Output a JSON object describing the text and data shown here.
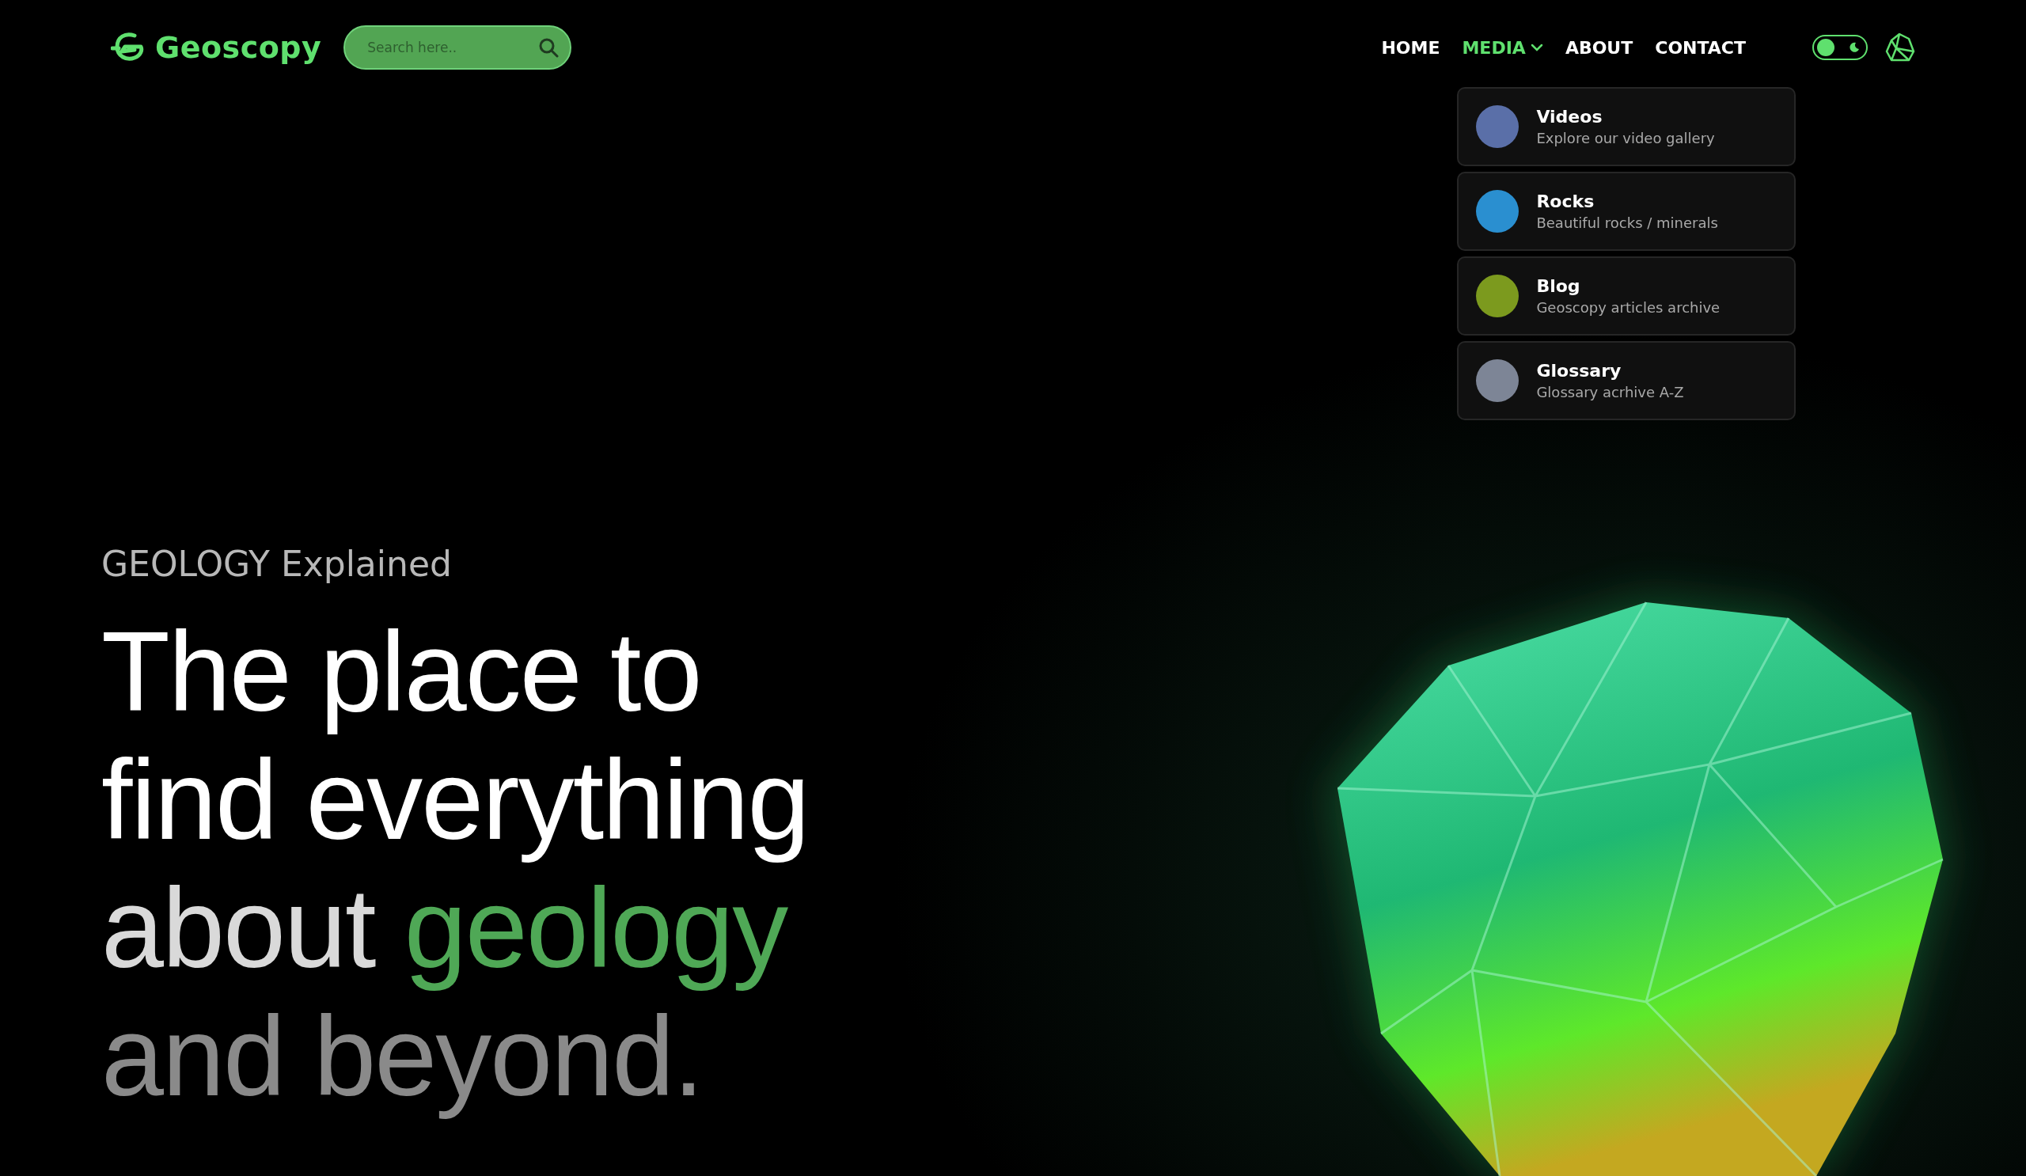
{
  "brand": {
    "name": "Geoscopy"
  },
  "search": {
    "placeholder": "Search here.."
  },
  "nav": [
    {
      "label": "HOME",
      "selected": false,
      "kind": "link"
    },
    {
      "label": "MEDIA",
      "selected": true,
      "kind": "menu"
    },
    {
      "label": "ABOUT",
      "selected": false,
      "kind": "link"
    },
    {
      "label": "CONTACT",
      "selected": false,
      "kind": "link"
    }
  ],
  "theme_toggle": {
    "on": false
  },
  "media_menu": [
    {
      "title": "Videos",
      "subtitle": "Explore our video gallery",
      "color": "#5a6fa8"
    },
    {
      "title": "Rocks",
      "subtitle": "Beautiful rocks / minerals",
      "color": "#2a8fd0"
    },
    {
      "title": "Blog",
      "subtitle": "Geoscopy articles archive",
      "color": "#7c9a1e"
    },
    {
      "title": "Glossary",
      "subtitle": "Glossary acrhive A-Z",
      "color": "#7d8596"
    }
  ],
  "hero": {
    "eyebrow": "GEOLOGY Explained",
    "lines": [
      [
        {
          "text": "The place to",
          "color": "#ffffff"
        }
      ],
      [
        {
          "text": "find everything",
          "color": "#ffffff"
        }
      ],
      [
        {
          "text": "about ",
          "color": "#d9d9d9"
        },
        {
          "text": "geology",
          "color": "#4fa856"
        }
      ],
      [
        {
          "text": "and beyond.",
          "color": "#8a8a8a"
        }
      ]
    ]
  }
}
